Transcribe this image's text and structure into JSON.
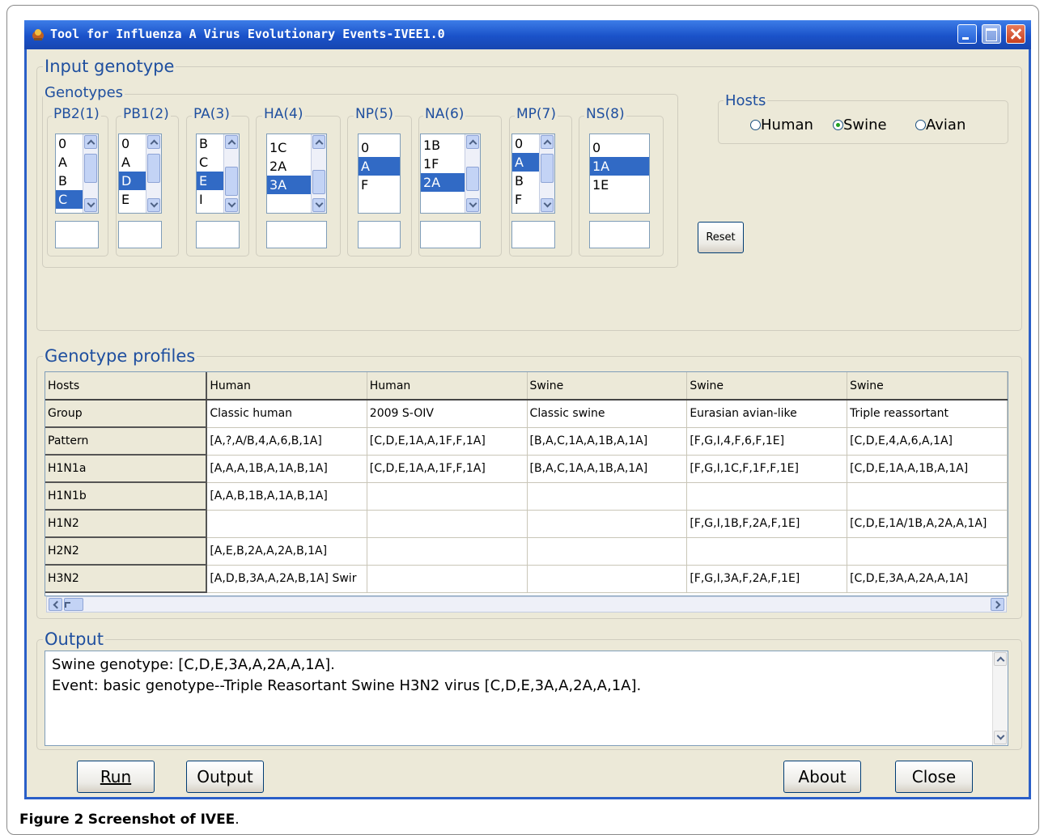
{
  "window": {
    "title": "Tool for Influenza A Virus Evolutionary Events-IVEE1.0"
  },
  "input_section": {
    "title": "Input genotype",
    "genotypes_label": "Genotypes",
    "segments": [
      {
        "name": "PB2(1)",
        "options": [
          "0",
          "A",
          "B",
          "C"
        ],
        "selected": "C"
      },
      {
        "name": "PB1(2)",
        "options": [
          "0",
          "A",
          "D",
          "E"
        ],
        "selected": "D"
      },
      {
        "name": "PA(3)",
        "options": [
          "B",
          "C",
          "E",
          "I"
        ],
        "selected": "E"
      },
      {
        "name": "HA(4)",
        "options": [
          "1C",
          "2A",
          "3A"
        ],
        "selected": "3A"
      },
      {
        "name": "NP(5)",
        "options": [
          "0",
          "A",
          "F"
        ],
        "selected": "A"
      },
      {
        "name": "NA(6)",
        "options": [
          "1B",
          "1F",
          "2A"
        ],
        "selected": "2A"
      },
      {
        "name": "MP(7)",
        "options": [
          "0",
          "A",
          "B",
          "F"
        ],
        "selected": "A"
      },
      {
        "name": "NS(8)",
        "options": [
          "0",
          "1A",
          "1E"
        ],
        "selected": "1A"
      }
    ],
    "hosts": {
      "label": "Hosts",
      "options": [
        "Human",
        "Swine",
        "Avian"
      ],
      "selected": "Swine"
    },
    "reset_label": "Reset"
  },
  "profiles": {
    "title": "Genotype profiles",
    "rows": [
      [
        "Hosts",
        "Human",
        "Human",
        "Swine",
        "Swine",
        "Swine"
      ],
      [
        "Group",
        "Classic human",
        "2009 S-OIV",
        "Classic swine",
        "Eurasian avian-like",
        "Triple reassortant"
      ],
      [
        "Pattern",
        "[A,?,A/B,4,A,6,B,1A]",
        "[C,D,E,1A,A,1F,F,1A]",
        "[B,A,C,1A,A,1B,A,1A]",
        "[F,G,I,4,F,6,F,1E]",
        "[C,D,E,4,A,6,A,1A]"
      ],
      [
        "H1N1a",
        "[A,A,A,1B,A,1A,B,1A]",
        "[C,D,E,1A,A,1F,F,1A]",
        "[B,A,C,1A,A,1B,A,1A]",
        "[F,G,I,1C,F,1F,F,1E]",
        "[C,D,E,1A,A,1B,A,1A]"
      ],
      [
        "H1N1b",
        "[A,A,B,1B,A,1A,B,1A]",
        "",
        "",
        "",
        ""
      ],
      [
        "H1N2",
        "",
        "",
        "",
        "[F,G,I,1B,F,2A,F,1E]",
        "[C,D,E,1A/1B,A,2A,A,1A]"
      ],
      [
        "H2N2",
        "[A,E,B,2A,A,2A,B,1A]",
        "",
        "",
        "",
        ""
      ],
      [
        "H3N2",
        "[A,D,B,3A,A,2A,B,1A] Swir",
        "",
        "",
        "[F,G,I,3A,F,2A,F,1E]",
        "[C,D,E,3A,A,2A,A,1A]"
      ]
    ]
  },
  "output": {
    "title": "Output",
    "lines": [
      "Swine genotype: [C,D,E,3A,A,2A,A,1A].",
      "Event: basic genotype--Triple Reasortant Swine H3N2 virus [C,D,E,3A,A,2A,A,1A]."
    ]
  },
  "buttons": {
    "run": "Run",
    "output": "Output",
    "about": "About",
    "close": "Close"
  },
  "caption": {
    "label": "Figure 2",
    "text": "Screenshot of IVEE",
    "end": "."
  }
}
